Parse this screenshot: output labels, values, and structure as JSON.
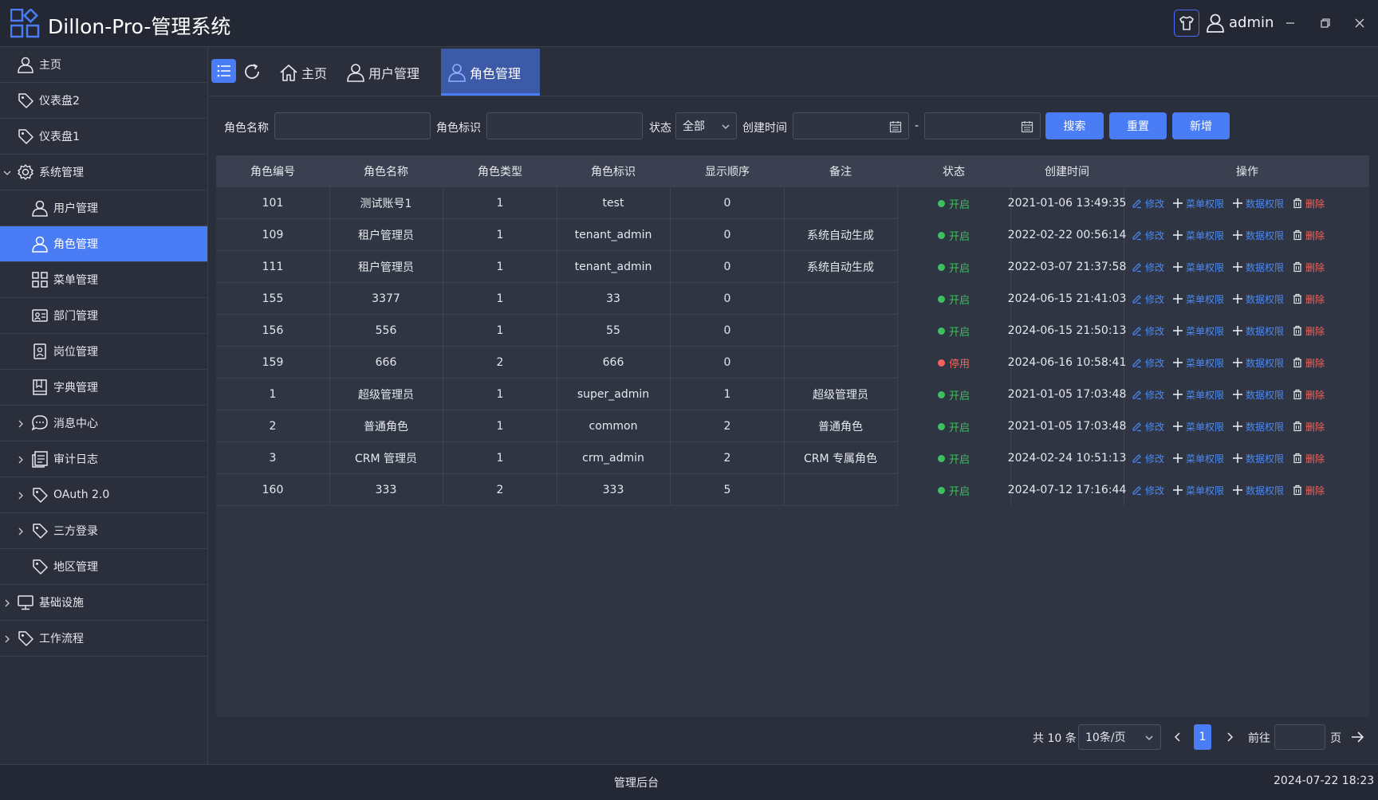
{
  "app": {
    "title": "Dillon-Pro-管理系统",
    "username": "admin"
  },
  "sidebar": {
    "items": [
      {
        "label": "主页",
        "icon": "user-icon"
      },
      {
        "label": "仪表盘2",
        "icon": "tag-icon"
      },
      {
        "label": "仪表盘1",
        "icon": "tag-icon"
      },
      {
        "label": "系统管理",
        "icon": "gear-icon"
      },
      {
        "label": "用户管理",
        "icon": "user-icon"
      },
      {
        "label": "角色管理",
        "icon": "user-icon"
      },
      {
        "label": "菜单管理",
        "icon": "grid-icon"
      },
      {
        "label": "部门管理",
        "icon": "id-card-icon"
      },
      {
        "label": "岗位管理",
        "icon": "badge-icon"
      },
      {
        "label": "字典管理",
        "icon": "book-icon"
      },
      {
        "label": "消息中心",
        "icon": "chat-icon"
      },
      {
        "label": "审计日志",
        "icon": "document-icon"
      },
      {
        "label": "OAuth 2.0",
        "icon": "tag-icon"
      },
      {
        "label": "三方登录",
        "icon": "tag-icon"
      },
      {
        "label": "地区管理",
        "icon": "tag-icon"
      },
      {
        "label": "基础设施",
        "icon": "monitor-icon"
      },
      {
        "label": "工作流程",
        "icon": "tag-icon"
      }
    ]
  },
  "tabs": [
    {
      "label": "主页",
      "icon": "home-icon"
    },
    {
      "label": "用户管理",
      "icon": "user-icon"
    },
    {
      "label": "角色管理",
      "icon": "user-icon"
    }
  ],
  "search": {
    "role_name_label": "角色名称",
    "role_key_label": "角色标识",
    "status_label": "状态",
    "status_value": "全部",
    "created_label": "创建时间",
    "date_sep": "-",
    "search_button": "搜索",
    "reset_button": "重置",
    "add_button": "新增"
  },
  "table": {
    "headers": [
      "角色编号",
      "角色名称",
      "角色类型",
      "角色标识",
      "显示顺序",
      "备注",
      "状态",
      "创建时间",
      "操作"
    ],
    "rows": [
      {
        "id": "101",
        "name": "测试账号1",
        "type": "1",
        "key": "test",
        "order": "0",
        "remark": "",
        "status": "开启",
        "created": "2021-01-06 13:49:35"
      },
      {
        "id": "109",
        "name": "租户管理员",
        "type": "1",
        "key": "tenant_admin",
        "order": "0",
        "remark": "系统自动生成",
        "status": "开启",
        "created": "2022-02-22 00:56:14"
      },
      {
        "id": "111",
        "name": "租户管理员",
        "type": "1",
        "key": "tenant_admin",
        "order": "0",
        "remark": "系统自动生成",
        "status": "开启",
        "created": "2022-03-07 21:37:58"
      },
      {
        "id": "155",
        "name": "3377",
        "type": "1",
        "key": "33",
        "order": "0",
        "remark": "",
        "status": "开启",
        "created": "2024-06-15 21:41:03"
      },
      {
        "id": "156",
        "name": "556",
        "type": "1",
        "key": "55",
        "order": "0",
        "remark": "",
        "status": "开启",
        "created": "2024-06-15 21:50:13"
      },
      {
        "id": "159",
        "name": "666",
        "type": "2",
        "key": "666",
        "order": "0",
        "remark": "",
        "status": "停用",
        "created": "2024-06-16 10:58:41"
      },
      {
        "id": "1",
        "name": "超级管理员",
        "type": "1",
        "key": "super_admin",
        "order": "1",
        "remark": "超级管理员",
        "status": "开启",
        "created": "2021-01-05 17:03:48"
      },
      {
        "id": "2",
        "name": "普通角色",
        "type": "1",
        "key": "common",
        "order": "2",
        "remark": "普通角色",
        "status": "开启",
        "created": "2021-01-05 17:03:48"
      },
      {
        "id": "3",
        "name": "CRM 管理员",
        "type": "1",
        "key": "crm_admin",
        "order": "2",
        "remark": "CRM 专属角色",
        "status": "开启",
        "created": "2024-02-24 10:51:13"
      },
      {
        "id": "160",
        "name": "333",
        "type": "2",
        "key": "333",
        "order": "5",
        "remark": "",
        "status": "开启",
        "created": "2024-07-12 17:16:44"
      }
    ],
    "ops": {
      "edit": "修改",
      "menu_perm": "菜单权限",
      "data_perm": "数据权限",
      "delete": "删除"
    }
  },
  "pagination": {
    "total": "共 10 条",
    "page_size": "10条/页",
    "current_page": "1",
    "goto_label": "前往",
    "page_suffix": "页"
  },
  "footer": {
    "title": "管理后台",
    "datetime": "2024-07-22 18:23"
  },
  "colors": {
    "accent": "#4a7df5",
    "status_on": "#3fbf5f",
    "status_off": "#f0645c",
    "link": "#4a8af5"
  }
}
